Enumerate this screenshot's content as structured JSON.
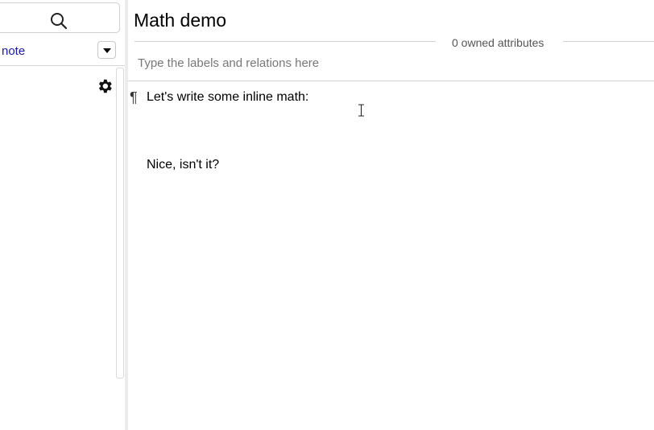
{
  "left_panel": {
    "search_icon": "search-icon",
    "note_link": "note",
    "dropdown_icon": "chevron-down-icon",
    "settings_icon": "gear-icon"
  },
  "note": {
    "title": "Math demo",
    "owned_attributes": "0 owned attributes",
    "attributes_placeholder": "Type the labels and relations here",
    "paragraph_marker": "¶",
    "paragraphs": [
      "Let's write some inline math:",
      "Nice, isn't it?"
    ]
  }
}
